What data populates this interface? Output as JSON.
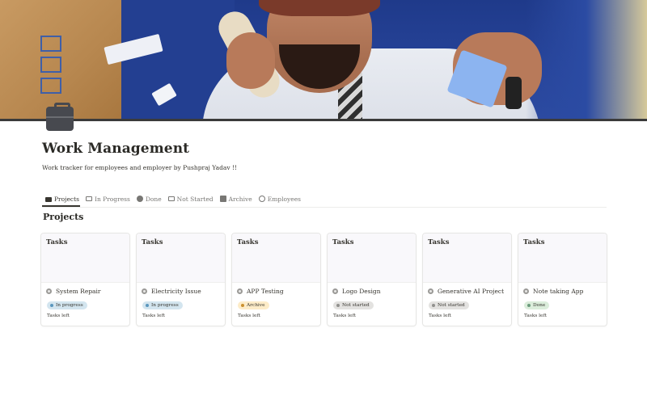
{
  "page": {
    "title": "Work Management",
    "subtitle": "Work tracker for employees and employer  by Pushpraj Yadav !!",
    "icon": "briefcase-icon"
  },
  "tabs": [
    {
      "label": "Projects",
      "icon": "folder-icon",
      "active": true
    },
    {
      "label": "In Progress",
      "icon": "monitor-icon",
      "active": false
    },
    {
      "label": "Done",
      "icon": "check-circle-icon",
      "active": false
    },
    {
      "label": "Not Started",
      "icon": "monitor-icon",
      "active": false
    },
    {
      "label": "Archive",
      "icon": "archive-icon",
      "active": false
    },
    {
      "label": "Employees",
      "icon": "user-circle-icon",
      "active": false
    }
  ],
  "section": {
    "heading": "Projects"
  },
  "cards": [
    {
      "preview_title": "Tasks",
      "name": "System Repair",
      "status": "In progress",
      "tasks_left": "Tasks left"
    },
    {
      "preview_title": "Tasks",
      "name": "Electricity Issue",
      "status": "In progress",
      "tasks_left": "Tasks left"
    },
    {
      "preview_title": "Tasks",
      "name": "APP Testing",
      "status": "Archive",
      "tasks_left": "Tasks left"
    },
    {
      "preview_title": "Tasks",
      "name": "Logo Design",
      "status": "Not started",
      "tasks_left": "Tasks left"
    },
    {
      "preview_title": "Tasks",
      "name": "Generative AI Project",
      "status": "Not started",
      "tasks_left": "Tasks left"
    },
    {
      "preview_title": "Tasks",
      "name": "Note taking App",
      "status": "Done",
      "tasks_left": "Tasks left"
    }
  ],
  "status_colors": {
    "In progress": {
      "bg": "#d3e5ef",
      "dot": "#5b97bd"
    },
    "Archive": {
      "bg": "#fdecc8",
      "dot": "#cb912f"
    },
    "Not started": {
      "bg": "#e3e2e0",
      "dot": "#91918e"
    },
    "Done": {
      "bg": "#dbeddb",
      "dot": "#6c9b7d"
    }
  }
}
